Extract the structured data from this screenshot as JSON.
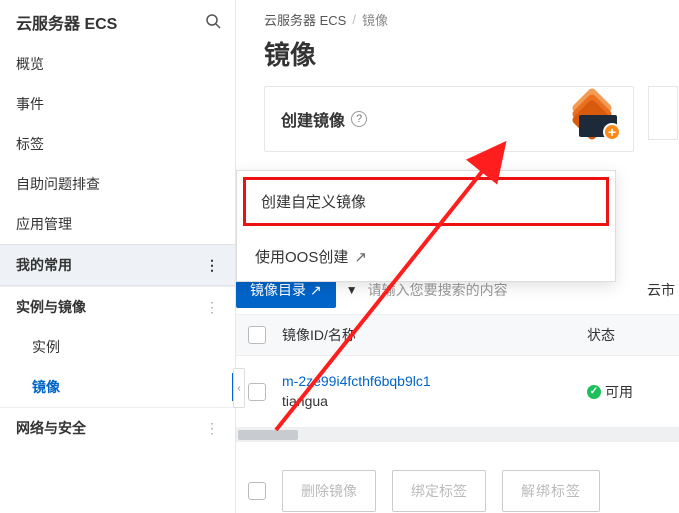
{
  "sidebar": {
    "title": "云服务器 ECS",
    "items": {
      "overview": "概览",
      "events": "事件",
      "tags": "标签",
      "selfcheck": "自助问题排查",
      "appmgr": "应用管理"
    },
    "fav_label": "我的常用",
    "group_instances": "实例与镜像",
    "sub_instance": "实例",
    "sub_image": "镜像",
    "group_network": "网络与安全"
  },
  "breadcrumb": {
    "root": "云服务器 ECS",
    "current": "镜像"
  },
  "page_title": "镜像",
  "create_card": {
    "title": "创建镜像"
  },
  "dropdown": {
    "custom": "创建自定义镜像",
    "oos": "使用OOS创建"
  },
  "toolbar": {
    "primary_btn": "镜像目录",
    "search_placeholder": "请输入您要搜索的内容",
    "cutoff": "云市"
  },
  "table": {
    "col_id": "镜像ID/名称",
    "col_status": "状态",
    "row1": {
      "id": "m-2ze99i4fcthf6bqb9lc1",
      "name": "tiangua",
      "status": "可用"
    }
  },
  "footer": {
    "delete": "删除镜像",
    "bind": "绑定标签",
    "unbind": "解绑标签"
  }
}
